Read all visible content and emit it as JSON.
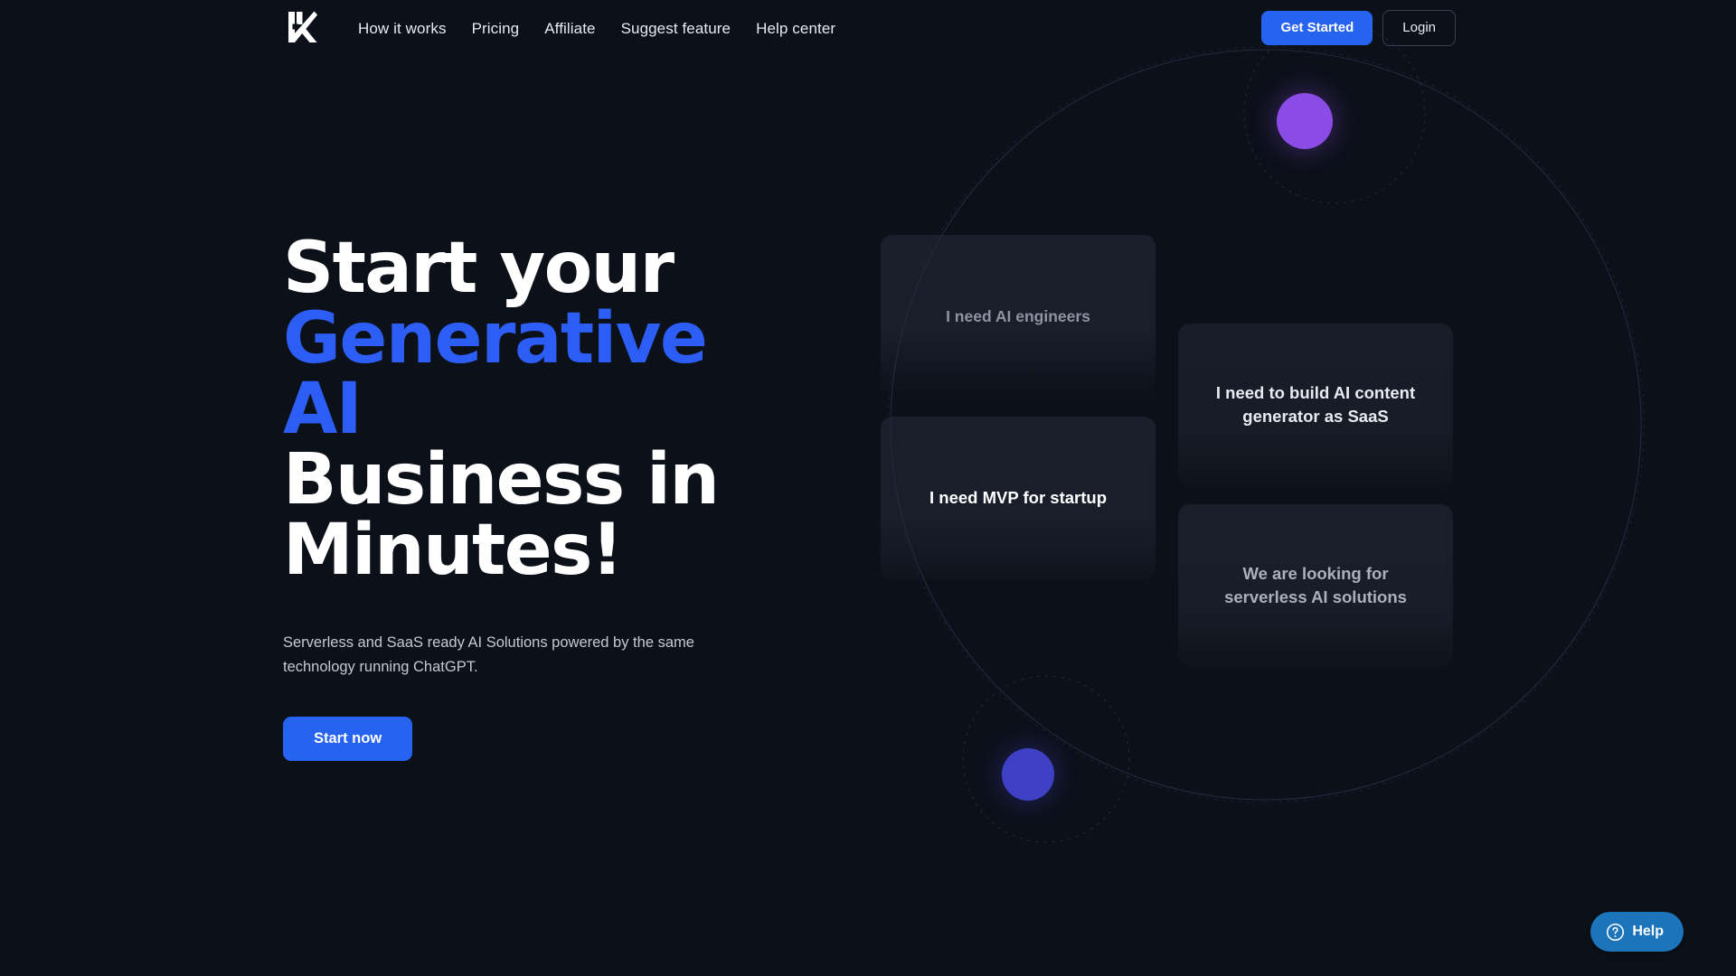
{
  "brand": {
    "logo_icon": "k-logo-icon",
    "accent_blue": "#2563f0",
    "background": "#0c1019"
  },
  "header": {
    "nav": [
      {
        "label": "How it works"
      },
      {
        "label": "Pricing"
      },
      {
        "label": "Affiliate"
      },
      {
        "label": "Suggest feature"
      },
      {
        "label": "Help center"
      }
    ],
    "get_started_label": "Get Started",
    "login_label": "Login"
  },
  "hero": {
    "title_line_1": "Start your",
    "title_line_2_accent": "Generative AI",
    "title_line_3": "Business in",
    "title_line_4": "Minutes!",
    "subtitle": "Serverless and SaaS ready AI Solutions powered by the same technology running ChatGPT.",
    "cta_label": "Start now"
  },
  "cards": [
    {
      "text": "I need AI engineers"
    },
    {
      "text": "I need MVP for startup"
    },
    {
      "text": "I need to build AI content generator as SaaS"
    },
    {
      "text": "We are looking for serverless AI solutions"
    }
  ],
  "decor": {
    "purple_dot_color": "#8b4ce6",
    "blue_dot_color": "#3f41c4",
    "orbit_stroke": "#222839"
  },
  "help_widget": {
    "label": "Help",
    "icon": "question-mark-circle-icon",
    "color": "#1c74bb"
  }
}
